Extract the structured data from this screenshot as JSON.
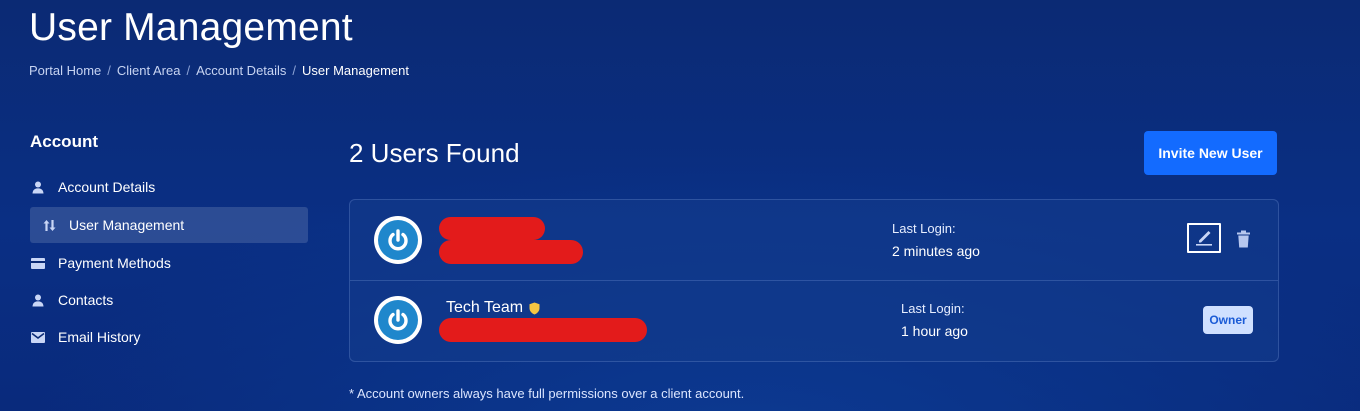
{
  "header": {
    "title": "User Management",
    "breadcrumb": [
      "Portal Home",
      "Client Area",
      "Account Details",
      "User Management"
    ],
    "breadcrumb_separator": "/"
  },
  "sidebar": {
    "heading": "Account",
    "items": [
      {
        "label": "Account Details",
        "icon": "user-icon",
        "active": false
      },
      {
        "label": "User Management",
        "icon": "sort-arrows-icon",
        "active": true
      },
      {
        "label": "Payment Methods",
        "icon": "credit-card-icon",
        "active": false
      },
      {
        "label": "Contacts",
        "icon": "user-icon",
        "active": false
      },
      {
        "label": "Email History",
        "icon": "envelope-icon",
        "active": false
      }
    ]
  },
  "main": {
    "users_found": "2 Users Found",
    "invite_button": "Invite New User",
    "users": [
      {
        "name": "",
        "name_redacted": true,
        "email_redacted": true,
        "last_login_label": "Last Login:",
        "last_login_value": "2 minutes ago",
        "actions": [
          "edit-icon",
          "trash-icon"
        ]
      },
      {
        "name": "Tech Team",
        "owner_indicator_icon": "shield-icon",
        "email_redacted": true,
        "last_login_label": "Last Login:",
        "last_login_value": "1 hour ago",
        "badge": "Owner"
      }
    ],
    "footnote": "* Account owners always have full permissions over a client account."
  },
  "colors": {
    "background": "#0b2a74",
    "accent": "#136bff",
    "redaction": "#e31b1b",
    "owner_badge_bg": "#cfe0ff",
    "owner_badge_text": "#1a5bd6",
    "shield": "#f5c542"
  }
}
